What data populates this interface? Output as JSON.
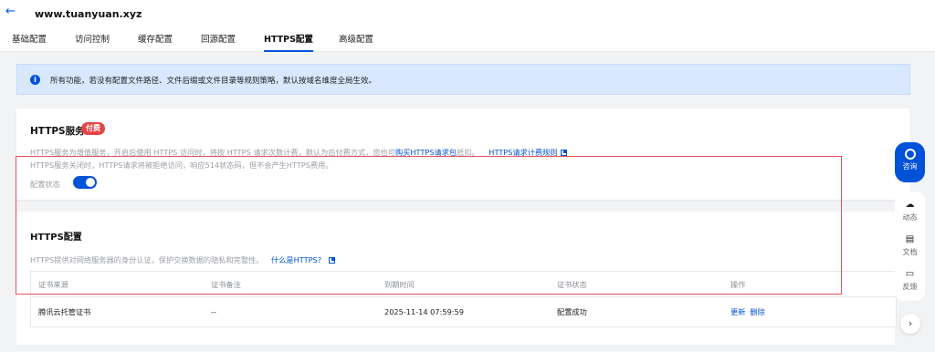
{
  "header": {
    "domain": "www.tuanyuan.xyz",
    "tabs": [
      {
        "label": "基础配置"
      },
      {
        "label": "访问控制"
      },
      {
        "label": "缓存配置"
      },
      {
        "label": "回源配置"
      },
      {
        "label": "HTTPS配置"
      },
      {
        "label": "高级配置"
      }
    ],
    "active_tab": "HTTPS配置"
  },
  "notice": {
    "text": "所有功能，若没有配置文件路径、文件后缀或文件目录等规则策略，默认按域名维度全局生效。"
  },
  "https_service": {
    "title": "HTTPS服务",
    "badge": "付费",
    "desc_line1_prefix": "HTTPS服务为增值服务，开启后使用 HTTPS 访问时，将按 HTTPS 请求次数计费，默认为后付费方式，您也可",
    "buy_link": "购买HTTPS请求包",
    "desc_line1_suffix": "抵扣。",
    "billing_link": "HTTPS请求计费规则",
    "desc_line2": "HTTPS服务关闭时，HTTPS请求将被拒绝访问，响应514状态码，但不会产生HTTPS费用。",
    "status_label": "配置状态",
    "enabled": true
  },
  "https_config": {
    "title": "HTTPS配置",
    "desc": "HTTPS提供对网络服务器的身份认证，保护交换数据的隐私和完整性。",
    "what_link": "什么是HTTPS?",
    "table": {
      "headers": [
        "证书来源",
        "证书备注",
        "到期时间",
        "证书状态",
        "操作"
      ],
      "rows": [
        {
          "source": "腾讯云托管证书",
          "remark": "--",
          "expire": "2025-11-14 07:59:59",
          "status": "配置成功",
          "actions": [
            "更新",
            "删除"
          ]
        }
      ]
    }
  },
  "side": {
    "help": "咨询",
    "items": [
      {
        "label": "动态",
        "icon": "cloud-bell-icon"
      },
      {
        "label": "文档",
        "icon": "book-icon"
      },
      {
        "label": "反馈",
        "icon": "feedback-icon"
      }
    ],
    "chevron": "›"
  },
  "colors": {
    "primary": "#0052d9",
    "badge": "#e54545",
    "notice_bg": "#d9e8ff",
    "highlight_border": "#e2545d"
  }
}
